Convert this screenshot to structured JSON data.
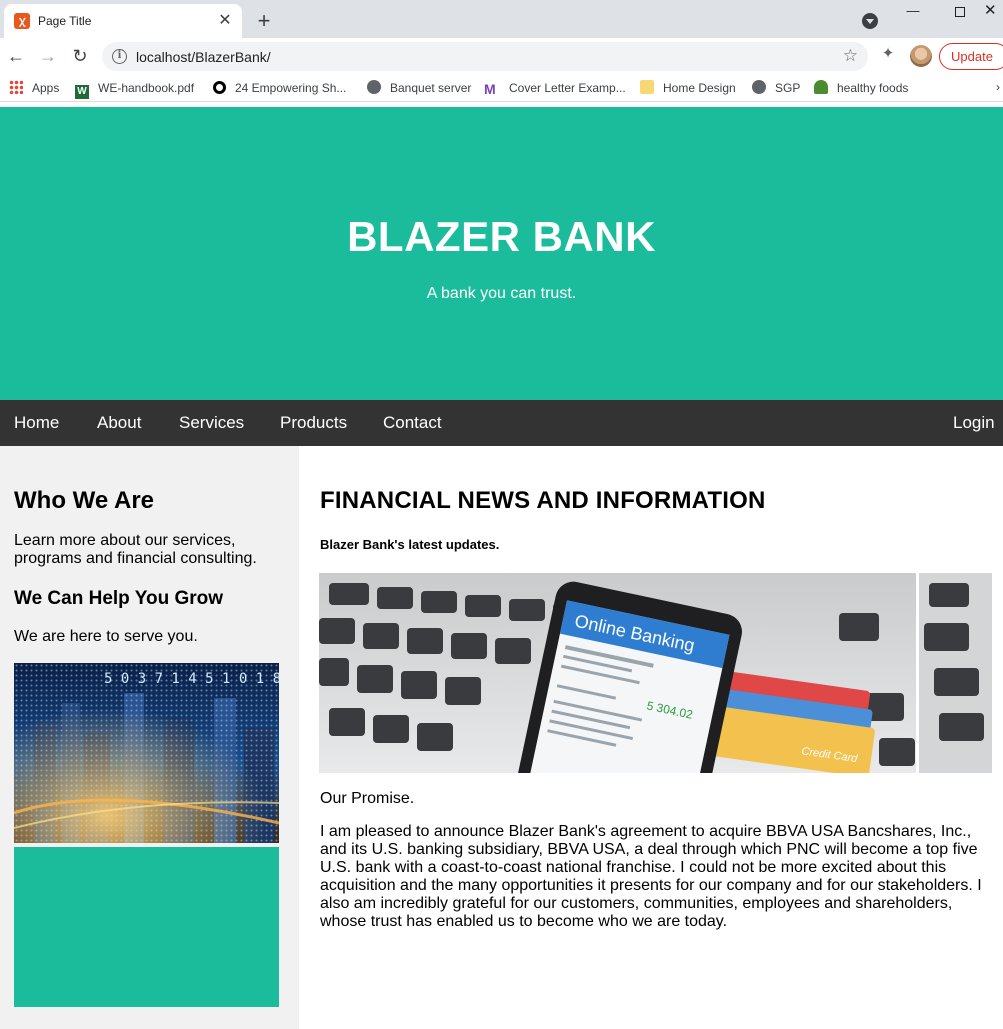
{
  "browser": {
    "tab_title": "Page Title",
    "url": "localhost/BlazerBank/",
    "update_label": "Update",
    "bookmarks": [
      {
        "label": "Apps",
        "icon": "apps-grid-icon"
      },
      {
        "label": "WE-handbook.pdf",
        "icon": "word-doc-icon"
      },
      {
        "label": "24 Empowering Sh...",
        "icon": "ring-logo-icon"
      },
      {
        "label": "Banquet server",
        "icon": "globe-icon"
      },
      {
        "label": "Cover Letter Examp...",
        "icon": "m-logo-icon"
      },
      {
        "label": "Home Design",
        "icon": "folder-icon"
      },
      {
        "label": "SGP",
        "icon": "globe-icon"
      },
      {
        "label": "healthy foods",
        "icon": "leaf-icon"
      }
    ]
  },
  "hero": {
    "title": "BLAZER BANK",
    "subtitle": "A bank you can trust."
  },
  "nav": {
    "home": "Home",
    "about": "About",
    "services": "Services",
    "products": "Products",
    "contact": "Contact",
    "login": "Login"
  },
  "sidebar": {
    "heading": "Who We Are",
    "intro": "Learn more about our services, programs and financial consulting.",
    "subheading": "We Can Help You Grow",
    "tagline": "We are here to serve you.",
    "image_numbers": "5 0 3 7 1 4 5 1 0 1 8"
  },
  "main": {
    "heading": "FINANCIAL NEWS AND INFORMATION",
    "subheading": "Blazer Bank's latest updates.",
    "banner": {
      "phone_title": "Online Banking",
      "balance": "5 304.02",
      "card_label": "Credit Card"
    },
    "promise_title": "Our Promise.",
    "article": "I am pleased to announce Blazer Bank's agreement to acquire BBVA USA Bancshares, Inc., and its U.S. banking subsidiary, BBVA USA, a deal through which PNC will become a top five U.S. bank with a coast-to-coast national franchise. I could not be more excited about this acquisition and the many opportunities it presents for our company and for our stakeholders. I also am incredibly grateful for our customers, communities, employees and shareholders, whose trust has enabled us to become who we are today."
  },
  "colors": {
    "accent": "#1abc9c",
    "navbar": "#333333",
    "sidebar_bg": "#f1f1f1"
  }
}
